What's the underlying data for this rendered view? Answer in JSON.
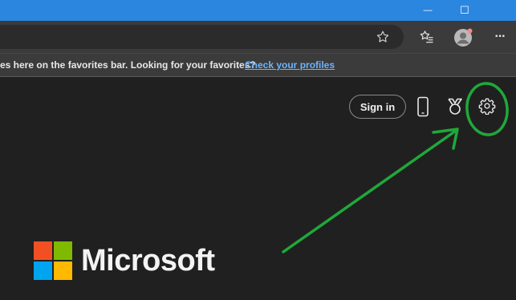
{
  "window": {
    "minimize_glyph": "—",
    "maximize_glyph": "☐"
  },
  "toolbar": {
    "favorite_icon": "star-outline-icon",
    "favorites_icon": "favorites-list-icon",
    "profile_icon": "profile-avatar-icon",
    "more_glyph": "···"
  },
  "favorites_bar": {
    "message": "es here on the favorites bar. Looking for your favorites?",
    "link": "Check your profiles"
  },
  "header": {
    "signin_label": "Sign in",
    "phone_icon": "phone-icon",
    "rewards_icon": "rewards-medal-icon",
    "settings_icon": "settings-gear-icon"
  },
  "brand": {
    "name": "Microsoft",
    "colors": {
      "red": "#f25022",
      "green": "#7fba00",
      "blue": "#00a4ef",
      "yellow": "#ffb900"
    }
  },
  "colors": {
    "titlebar": "#2b86e0",
    "toolbar": "#3b3b3b",
    "page_background": "#202020",
    "link": "#6cb4ff",
    "annotation": "#1fa83a"
  }
}
